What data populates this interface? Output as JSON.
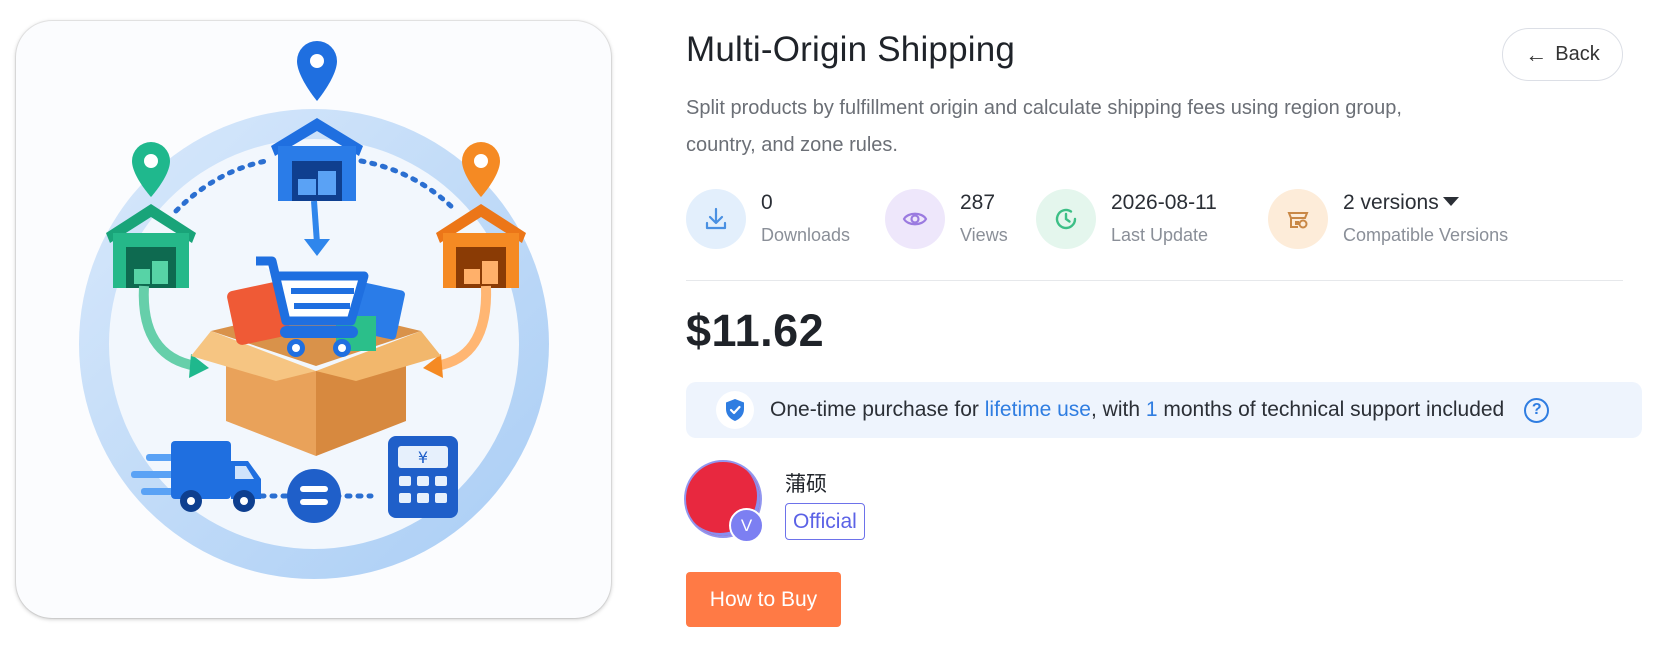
{
  "product": {
    "title": "Multi-Origin Shipping",
    "description": "Split products by fulfillment origin and calculate shipping fees using region group, country, and zone rules.",
    "price": "$11.62"
  },
  "nav": {
    "back_label": "Back"
  },
  "stats": [
    {
      "icon": "download-icon",
      "value": "0",
      "label": "Downloads",
      "color": "#e3effc"
    },
    {
      "icon": "eye-icon",
      "value": "287",
      "label": "Views",
      "color": "#eee7fb"
    },
    {
      "icon": "clock-icon",
      "value": "2026-08-11",
      "label": "Last Update",
      "color": "#e4f6ed"
    },
    {
      "icon": "store-plugin-icon",
      "value": "2 versions",
      "label": "Compatible Versions",
      "color": "#fdecd9"
    }
  ],
  "purchase_banner": {
    "prefix": "One-time purchase for ",
    "highlight_1": "lifetime use",
    "middle": ", with ",
    "highlight_2": "1",
    "suffix": " months of technical support included",
    "help": "?"
  },
  "author": {
    "name": "蒲硕",
    "badge_letter": "V",
    "official_label": "Official"
  },
  "actions": {
    "buy_label": "How to Buy"
  },
  "colors": {
    "accent": "#2f7de1",
    "buy": "#ff7a45",
    "official": "#5b62e6"
  }
}
